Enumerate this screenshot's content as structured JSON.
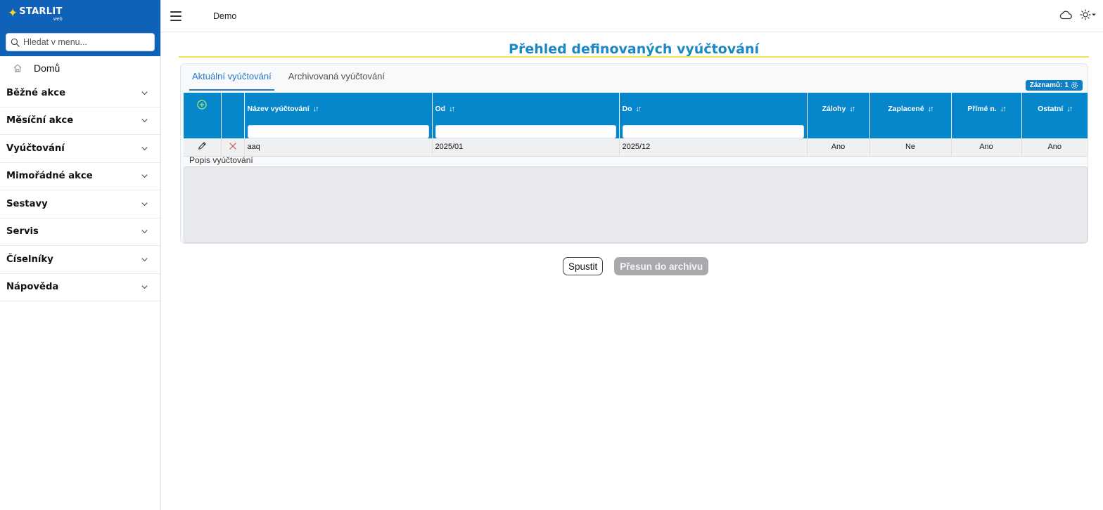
{
  "sidebar": {
    "logo_main": "STARLIT",
    "logo_sub": "web",
    "search_placeholder": "Hledat v menu...",
    "home_label": "Domů",
    "items": [
      {
        "label": "Běžné akce"
      },
      {
        "label": "Měsíční akce"
      },
      {
        "label": "Vyúčtování"
      },
      {
        "label": "Mimořádné akce"
      },
      {
        "label": "Sestavy"
      },
      {
        "label": "Servis"
      },
      {
        "label": "Číselníky"
      },
      {
        "label": "Nápověda"
      }
    ]
  },
  "topbar": {
    "title": "Demo",
    "icons": [
      "menu-icon",
      "cloud-icon",
      "sun-icon",
      "caret-down-icon"
    ]
  },
  "main": {
    "title": "Přehled definovaných vyúčtování",
    "tabs": [
      {
        "label": "Aktuální vyúčtování",
        "active": true
      },
      {
        "label": "Archivovaná vyúčtování",
        "active": false
      }
    ],
    "records_label": "Záznamů:",
    "records_count": "1",
    "columns": {
      "name": "Název vyúčtování",
      "from": "Od",
      "to": "Do",
      "deposits": "Zálohy",
      "paid": "Zaplacené",
      "direct": "Přímé n.",
      "other": "Ostatní"
    },
    "rows": [
      {
        "name": "aaq",
        "from": "2025/01",
        "to": "2025/12",
        "deposits": "Ano",
        "paid": "Ne",
        "direct": "Ano",
        "other": "Ano"
      }
    ],
    "description_label": "Popis vyúčtování",
    "buttons": {
      "run": "Spustit",
      "archive": "Přesun do archivu"
    }
  },
  "colors": {
    "brand_blue": "#0f62b8",
    "header_blue": "#0687cb",
    "title_blue": "#1b87c5",
    "accent_yellow": "#f1e25e",
    "logo_star": "#f6d32d",
    "delete_red": "#d9534f",
    "add_green": "#9be07a"
  }
}
